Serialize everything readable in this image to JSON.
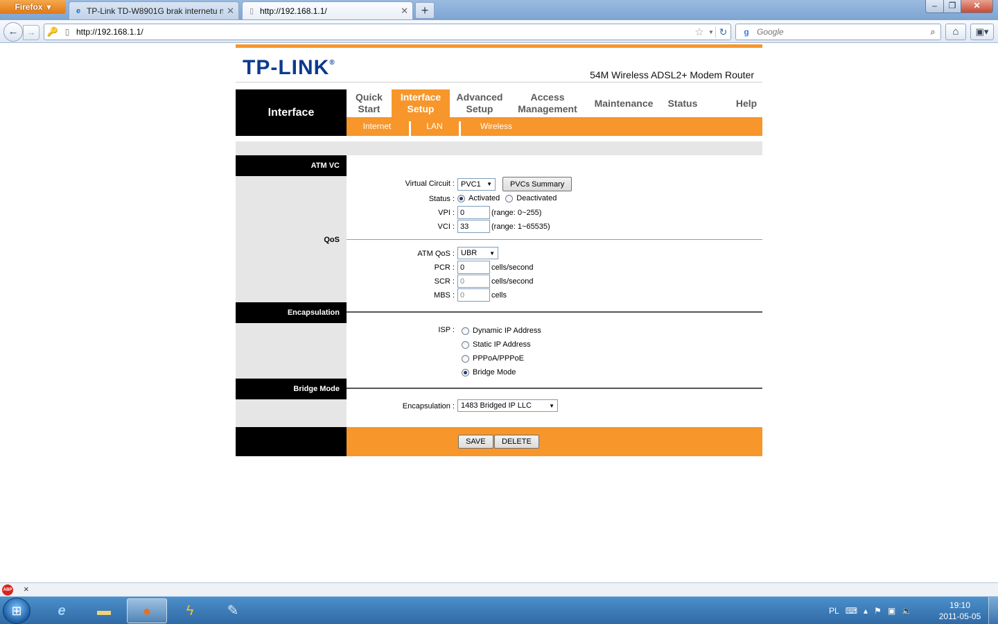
{
  "browser": {
    "menu_button": "Firefox",
    "tabs": [
      {
        "title": "TP-Link TD-W8901G brak internetu n...",
        "favicon": "ie-icon"
      },
      {
        "title": "http://192.168.1.1/",
        "favicon": "page-icon"
      }
    ],
    "new_tab": "+",
    "url": "http://192.168.1.1/",
    "search_placeholder": "Google",
    "search_engine": "g"
  },
  "router": {
    "brand": "TP-LINK",
    "brand_mark": "®",
    "model": "54M Wireless ADSL2+ Modem Router",
    "section_title": "Interface",
    "menu": [
      {
        "line1": "Quick",
        "line2": "Start"
      },
      {
        "line1": "Interface",
        "line2": "Setup"
      },
      {
        "line1": "Advanced",
        "line2": "Setup"
      },
      {
        "line1": "Access",
        "line2": "Management"
      },
      {
        "line1": "Maintenance",
        "line2": ""
      },
      {
        "line1": "Status",
        "line2": ""
      },
      {
        "line1": "Help",
        "line2": ""
      }
    ],
    "submenu": [
      "Internet",
      "LAN",
      "Wireless"
    ],
    "sections": {
      "atm_vc": "ATM VC",
      "qos": "QoS",
      "encapsulation": "Encapsulation",
      "bridge_mode": "Bridge Mode"
    },
    "atm": {
      "virtual_circuit_label": "Virtual Circuit :",
      "virtual_circuit_value": "PVC1",
      "pvcs_summary_button": "PVCs Summary",
      "status_label": "Status :",
      "status_activated": "Activated",
      "status_deactivated": "Deactivated",
      "status_selected": "Activated",
      "vpi_label": "VPI :",
      "vpi_value": "0",
      "vpi_range": "(range: 0~255)",
      "vci_label": "VCI :",
      "vci_value": "33",
      "vci_range": "(range: 1~65535)"
    },
    "qos": {
      "atm_qos_label": "ATM QoS :",
      "atm_qos_value": "UBR",
      "pcr_label": "PCR :",
      "pcr_value": "0",
      "pcr_unit": "cells/second",
      "scr_label": "SCR :",
      "scr_value": "0",
      "scr_unit": "cells/second",
      "mbs_label": "MBS :",
      "mbs_value": "0",
      "mbs_unit": "cells"
    },
    "isp": {
      "label": "ISP :",
      "options": [
        "Dynamic IP Address",
        "Static IP Address",
        "PPPoA/PPPoE",
        "Bridge Mode"
      ],
      "selected": "Bridge Mode"
    },
    "bridge": {
      "encapsulation_label": "Encapsulation :",
      "encapsulation_value": "1483 Bridged IP LLC"
    },
    "buttons": {
      "save": "SAVE",
      "delete": "DELETE"
    }
  },
  "addon_bar": {
    "abp": "ABP",
    "close": "×"
  },
  "taskbar": {
    "apps": [
      "internet-explorer-icon",
      "explorer-folder-icon",
      "firefox-icon",
      "winamp-icon",
      "paint-icon"
    ],
    "active_app": "firefox-icon",
    "language": "PL",
    "time": "19:10",
    "date": "2011-05-05"
  },
  "colors": {
    "accent_orange": "#f7962a",
    "brand_blue": "#0b3a8e",
    "panel_gray": "#e6e6e6"
  }
}
